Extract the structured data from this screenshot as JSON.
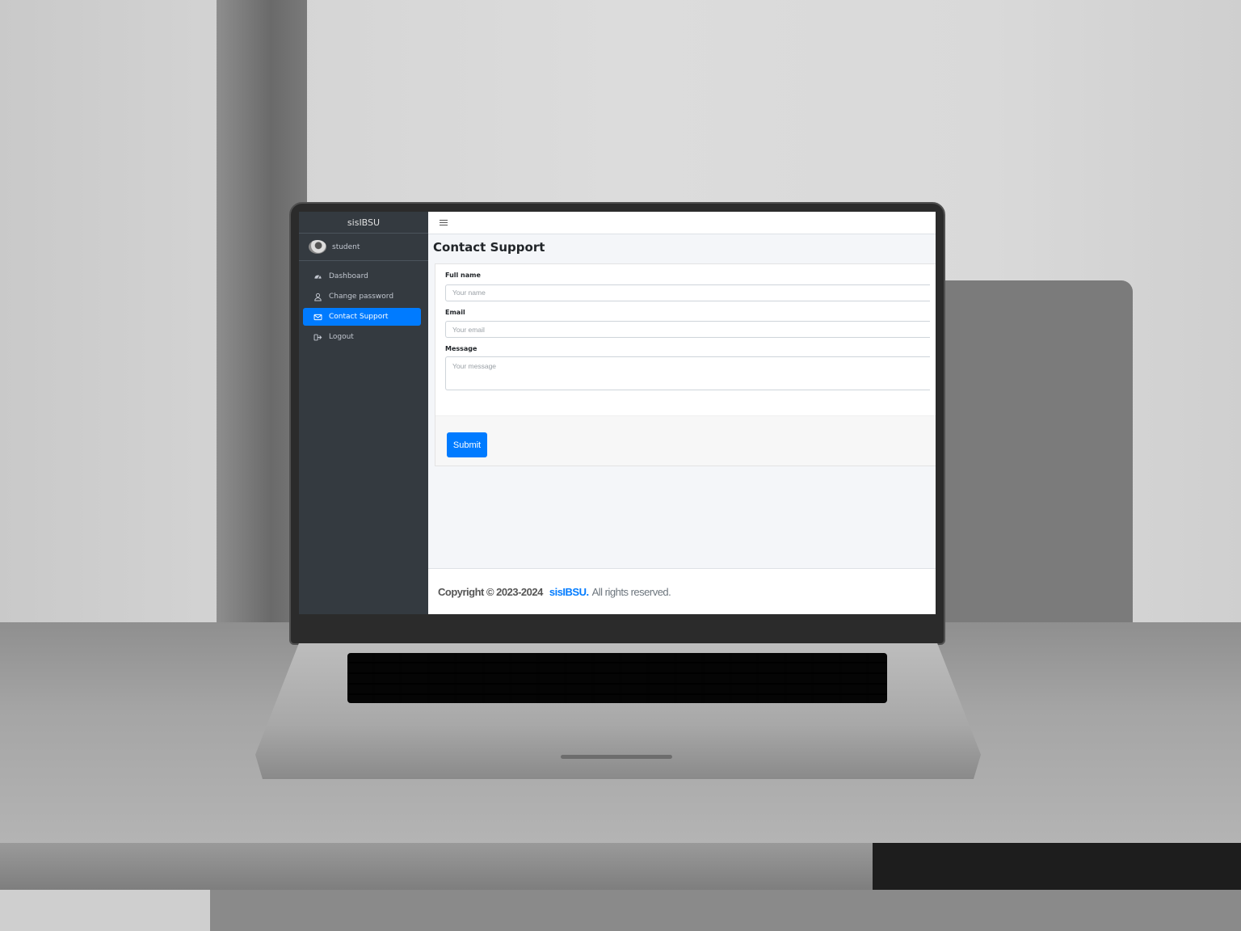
{
  "app": {
    "brand": "sisIBSU",
    "user": {
      "name": "student"
    }
  },
  "sidebar": {
    "items": [
      {
        "label": "Dashboard",
        "icon": "dashboard-icon",
        "active": false
      },
      {
        "label": "Change password",
        "icon": "user-icon",
        "active": false
      },
      {
        "label": "Contact Support",
        "icon": "envelope-icon",
        "active": true
      },
      {
        "label": "Logout",
        "icon": "logout-icon",
        "active": false
      }
    ]
  },
  "page": {
    "title": "Contact Support"
  },
  "form": {
    "fullname_label": "Full name",
    "fullname_placeholder": "Your name",
    "email_label": "Email",
    "email_placeholder": "Your email",
    "message_label": "Message",
    "message_placeholder": "Your message",
    "submit_label": "Submit"
  },
  "footer": {
    "copyright": "Copyright © 2023-2024",
    "brand": "sisIBSU.",
    "rights": "All rights reserved."
  },
  "colors": {
    "accent": "#007bff",
    "sidebar_bg": "#343a40",
    "content_bg": "#f4f6f9"
  }
}
